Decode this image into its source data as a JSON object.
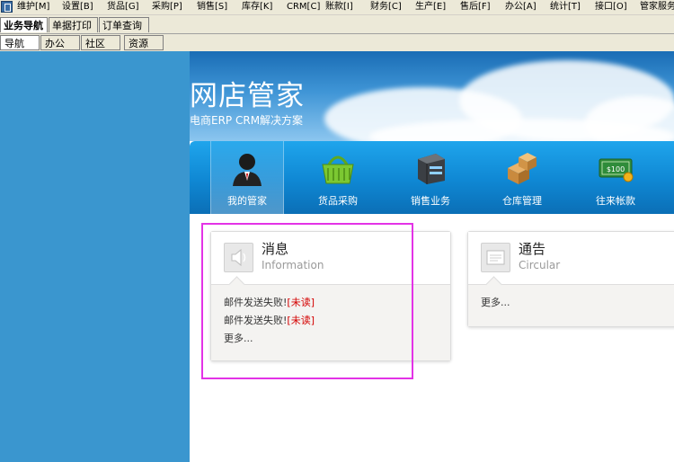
{
  "menu": {
    "items": [
      "维护[M]",
      "设置[B]",
      "货品[G]",
      "采购[P]",
      "销售[S]",
      "库存[K]",
      "CRM[C]",
      "账款[I]",
      "财务[C]",
      "生产[E]",
      "售后[F]",
      "办公[A]",
      "统计[T]",
      "接口[O]",
      "管家服务"
    ]
  },
  "tabs_main": [
    "业务导航",
    "单据打印",
    "订单查询"
  ],
  "tabs_sub": [
    "导航",
    "办公",
    "社区",
    "资源"
  ],
  "banner": {
    "title": "网店管家",
    "subtitle": "电商ERP  CRM解决方案"
  },
  "nav": {
    "items": [
      {
        "label": "我的管家",
        "icon": "person-icon"
      },
      {
        "label": "货品采购",
        "icon": "basket-icon"
      },
      {
        "label": "销售业务",
        "icon": "server-icon"
      },
      {
        "label": "仓库管理",
        "icon": "boxes-icon"
      },
      {
        "label": "往来帐款",
        "icon": "money-icon"
      }
    ]
  },
  "messages": {
    "title": "消息",
    "subtitle": "Information",
    "lines": [
      {
        "text": "邮件发送失败!",
        "status": "[未读]"
      },
      {
        "text": "邮件发送失败!",
        "status": "[未读]"
      }
    ],
    "more": "更多..."
  },
  "notice": {
    "title": "通告",
    "subtitle": "Circular",
    "more": "更多..."
  },
  "colors": {
    "left_pane": "#3a96cf",
    "nav_strip": "#0f87d3",
    "unread": "#d40000",
    "highlight": "#e333e6"
  }
}
